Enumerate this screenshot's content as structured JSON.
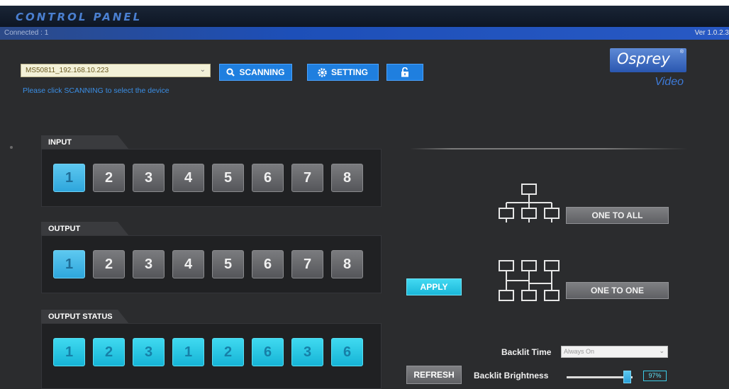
{
  "window": {
    "title": "CONTROL PANEL",
    "connection_status": "Connected : 1",
    "version": "Ver 1.0.2.3"
  },
  "device": {
    "selected": "MS50811_192.168.10.223",
    "hint": "Please click SCANNING to select the device"
  },
  "toolbar": {
    "scanning_label": "SCANNING",
    "setting_label": "SETTING"
  },
  "logo": {
    "name": "Osprey",
    "registered": "®",
    "sub": "Video"
  },
  "input": {
    "title": "INPUT",
    "buttons": [
      "1",
      "2",
      "3",
      "4",
      "5",
      "6",
      "7",
      "8"
    ],
    "selected": "1"
  },
  "output": {
    "title": "OUTPUT",
    "buttons": [
      "1",
      "2",
      "3",
      "4",
      "5",
      "6",
      "7",
      "8"
    ],
    "selected": "1"
  },
  "output_status": {
    "title": "OUTPUT STATUS",
    "values": [
      "1",
      "2",
      "3",
      "1",
      "2",
      "6",
      "3",
      "6"
    ]
  },
  "modes": {
    "one_to_all": "ONE TO ALL",
    "one_to_one": "ONE TO ONE"
  },
  "actions": {
    "apply": "APPLY",
    "refresh": "REFRESH"
  },
  "backlit": {
    "time_label": "Backlit Time",
    "time_value": "Always On",
    "brightness_label": "Backlit Brightness",
    "brightness_value": "97%",
    "brightness_level": 0.97
  },
  "colors": {
    "accent_blue": "#1f7fdf",
    "selected_cyan": "#2ea6dc",
    "status_cyan": "#16b4d6",
    "background": "#2b2c2e"
  },
  "icons": {
    "search": "search-icon",
    "gear": "gear-icon",
    "lock": "unlock-icon",
    "one_to_all": "network-tree-icon",
    "one_to_one": "network-pairs-icon"
  }
}
